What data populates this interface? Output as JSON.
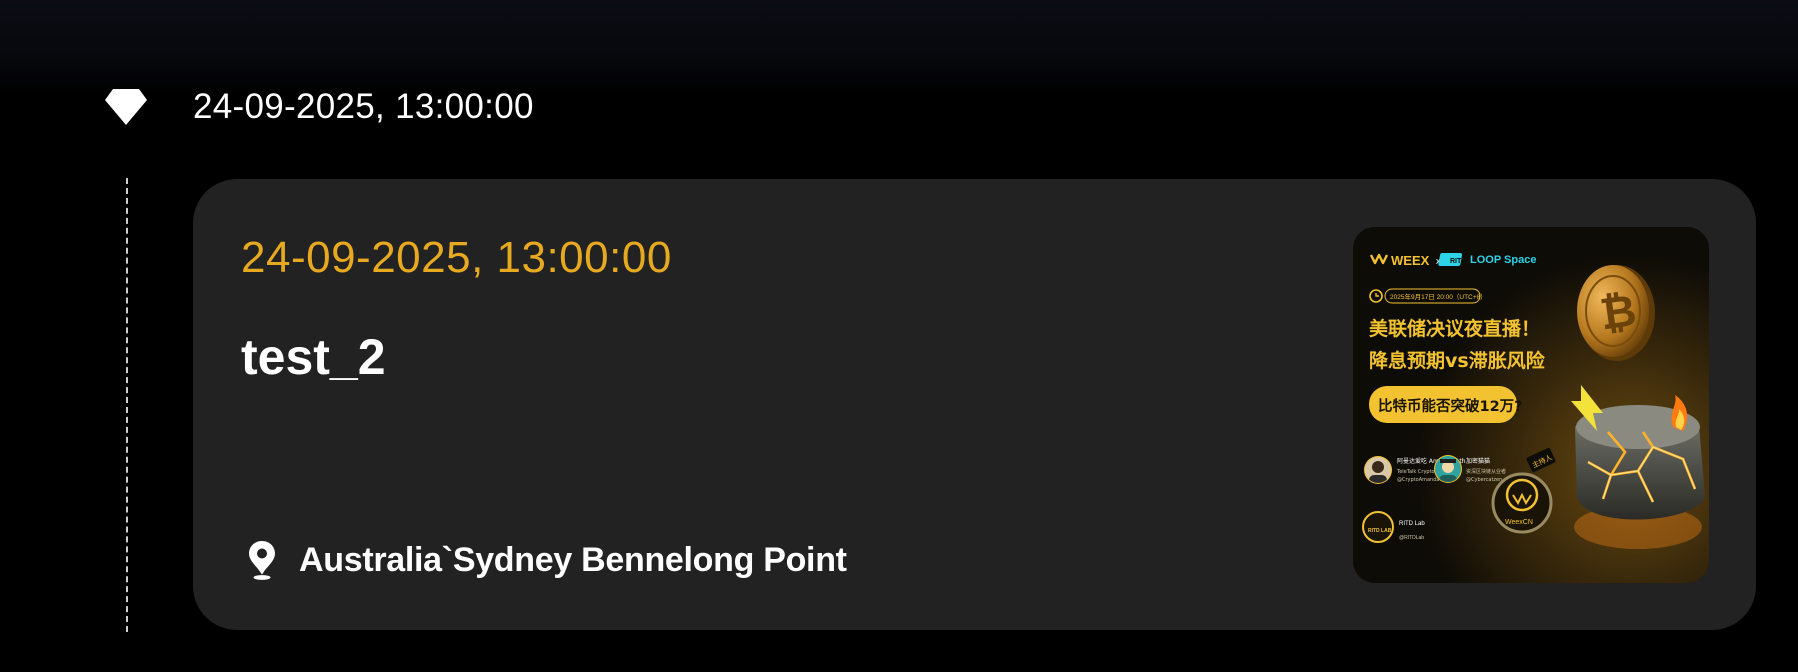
{
  "timeline": {
    "date": "24-09-2025, 13:00:00",
    "marker_icon": "diamond-icon"
  },
  "event": {
    "date": "24-09-2025, 13:00:00",
    "title": "test_2",
    "location_icon": "map-pin-icon",
    "location": "Australia`Sydney Bennelong Point",
    "poster": {
      "brand": "WEEX",
      "cross": "x",
      "partner_badge": "RITD",
      "partner": "LOOP Space",
      "schedule": "2025年9月17日 20:00（UTC+8）",
      "headline_1": "美联储决议夜直播！",
      "headline_2": "降息预期vs滞胀风险",
      "question": "比特币能否突破12万?",
      "speaker_1_name": "阿曼达爱吃 Amanda.eth",
      "speaker_1_role": "TeleTalk Crypto 创始人",
      "speaker_1_handle": "@CryptoAmanda",
      "speaker_2_name": "加密猫猫",
      "speaker_2_role": "资深区块链从业者",
      "speaker_2_handle": "@Cybercatzen",
      "host_tag": "主持人",
      "host_name": "WeexCN",
      "lab_name": "RITD Lab",
      "lab_handle": "@RITDLab",
      "lab_logo": "RITD LAB"
    }
  },
  "colors": {
    "background": "#000000",
    "card": "#222222",
    "accent": "#e6a91f",
    "text": "#ffffff",
    "poster_gold": "#f2c230",
    "poster_lava": "#ff8a1a"
  }
}
